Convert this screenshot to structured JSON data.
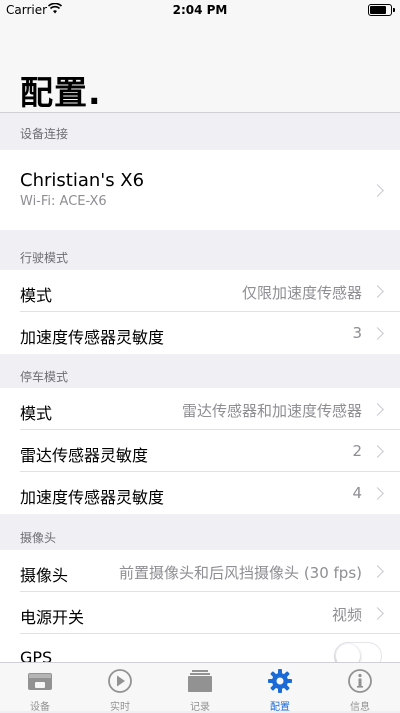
{
  "status_bar": {
    "carrier": "Carrier",
    "time": "2:04 PM",
    "battery_level": 0.9
  },
  "page_title": "配置.",
  "sections": {
    "device": {
      "header": "设备连接",
      "device_name": "Christian's X6",
      "wifi": "Wi-Fi: ACE-X6"
    },
    "driving": {
      "header": "行驶模式",
      "rows": [
        {
          "label": "模式",
          "value": "仅限加速度传感器"
        },
        {
          "label": "加速度传感器灵敏度",
          "value": "3"
        }
      ]
    },
    "parking": {
      "header": "停车模式",
      "rows": [
        {
          "label": "模式",
          "value": "雷达传感器和加速度传感器"
        },
        {
          "label": "雷达传感器灵敏度",
          "value": "2"
        },
        {
          "label": "加速度传感器灵敏度",
          "value": "4"
        }
      ]
    },
    "camera": {
      "header": "摄像头",
      "rows": [
        {
          "label": "摄像头",
          "value": "前置摄像头和后风挡摄像头 (30 fps)"
        },
        {
          "label": "电源开关",
          "value": "视频"
        },
        {
          "label": "GPS",
          "toggle_on": false
        }
      ]
    }
  },
  "tabs": [
    {
      "label": "设备",
      "icon": "dashcam-icon"
    },
    {
      "label": "实时",
      "icon": "play-circle-icon"
    },
    {
      "label": "记录",
      "icon": "stack-icon"
    },
    {
      "label": "配置",
      "icon": "gear-icon",
      "active": true
    },
    {
      "label": "信息",
      "icon": "info-icon"
    }
  ],
  "colors": {
    "accent": "#1a6bd8",
    "inactive_tab": "#929292",
    "background": "#efeff4"
  }
}
